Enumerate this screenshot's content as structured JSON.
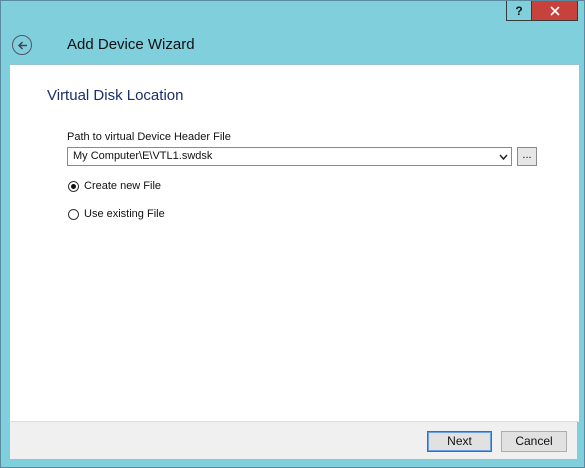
{
  "window": {
    "help_label": "?",
    "title": "Add Device Wizard"
  },
  "page": {
    "heading": "Virtual Disk Location",
    "path_label": "Path to virtual Device Header File",
    "path_value": "My Computer\\E\\VTL1.swdsk",
    "browse_label": "...",
    "options": [
      {
        "label": "Create new File",
        "checked": true
      },
      {
        "label": "Use existing File",
        "checked": false
      }
    ]
  },
  "footer": {
    "next_label": "Next",
    "cancel_label": "Cancel"
  }
}
